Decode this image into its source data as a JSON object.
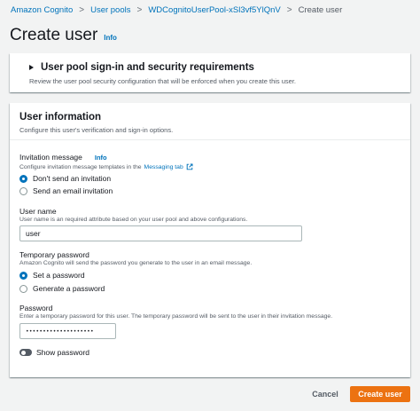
{
  "breadcrumb": {
    "items": [
      "Amazon Cognito",
      "User pools",
      "WDCognitoUserPool-xSl3vf5YlQnV"
    ],
    "current": "Create user",
    "separator": ">"
  },
  "page": {
    "title": "Create user",
    "info": "Info"
  },
  "security_section": {
    "title": "User pool sign-in and security requirements",
    "description": "Review the user pool security configuration that will be enforced when you create this user."
  },
  "user_info": {
    "title": "User information",
    "description": "Configure this user's verification and sign-in options.",
    "invitation": {
      "label": "Invitation message",
      "info": "Info",
      "description": "Configure invitation message templates in the",
      "link": "Messaging tab",
      "options": [
        "Don't send an invitation",
        "Send an email invitation"
      ],
      "selected": "Don't send an invitation"
    },
    "username": {
      "label": "User name",
      "description": "User name is an required attribute based on your user pool and above configurations.",
      "value": "user"
    },
    "temp_password": {
      "label": "Temporary password",
      "description": "Amazon Cognito will send the password you generate to the user in an email message.",
      "options": [
        "Set a password",
        "Generate a password"
      ],
      "selected": "Set a password"
    },
    "password": {
      "label": "Password",
      "description": "Enter a temporary password for this user. The temporary password will be sent to the user in their invitation message.",
      "value": "••••••••••••••••••••"
    },
    "show_password": {
      "label": "Show password",
      "enabled": false
    }
  },
  "actions": {
    "cancel": "Cancel",
    "create": "Create user"
  },
  "colors": {
    "link": "#0073bb",
    "primary_button": "#ec7211",
    "background": "#f2f3f3"
  }
}
